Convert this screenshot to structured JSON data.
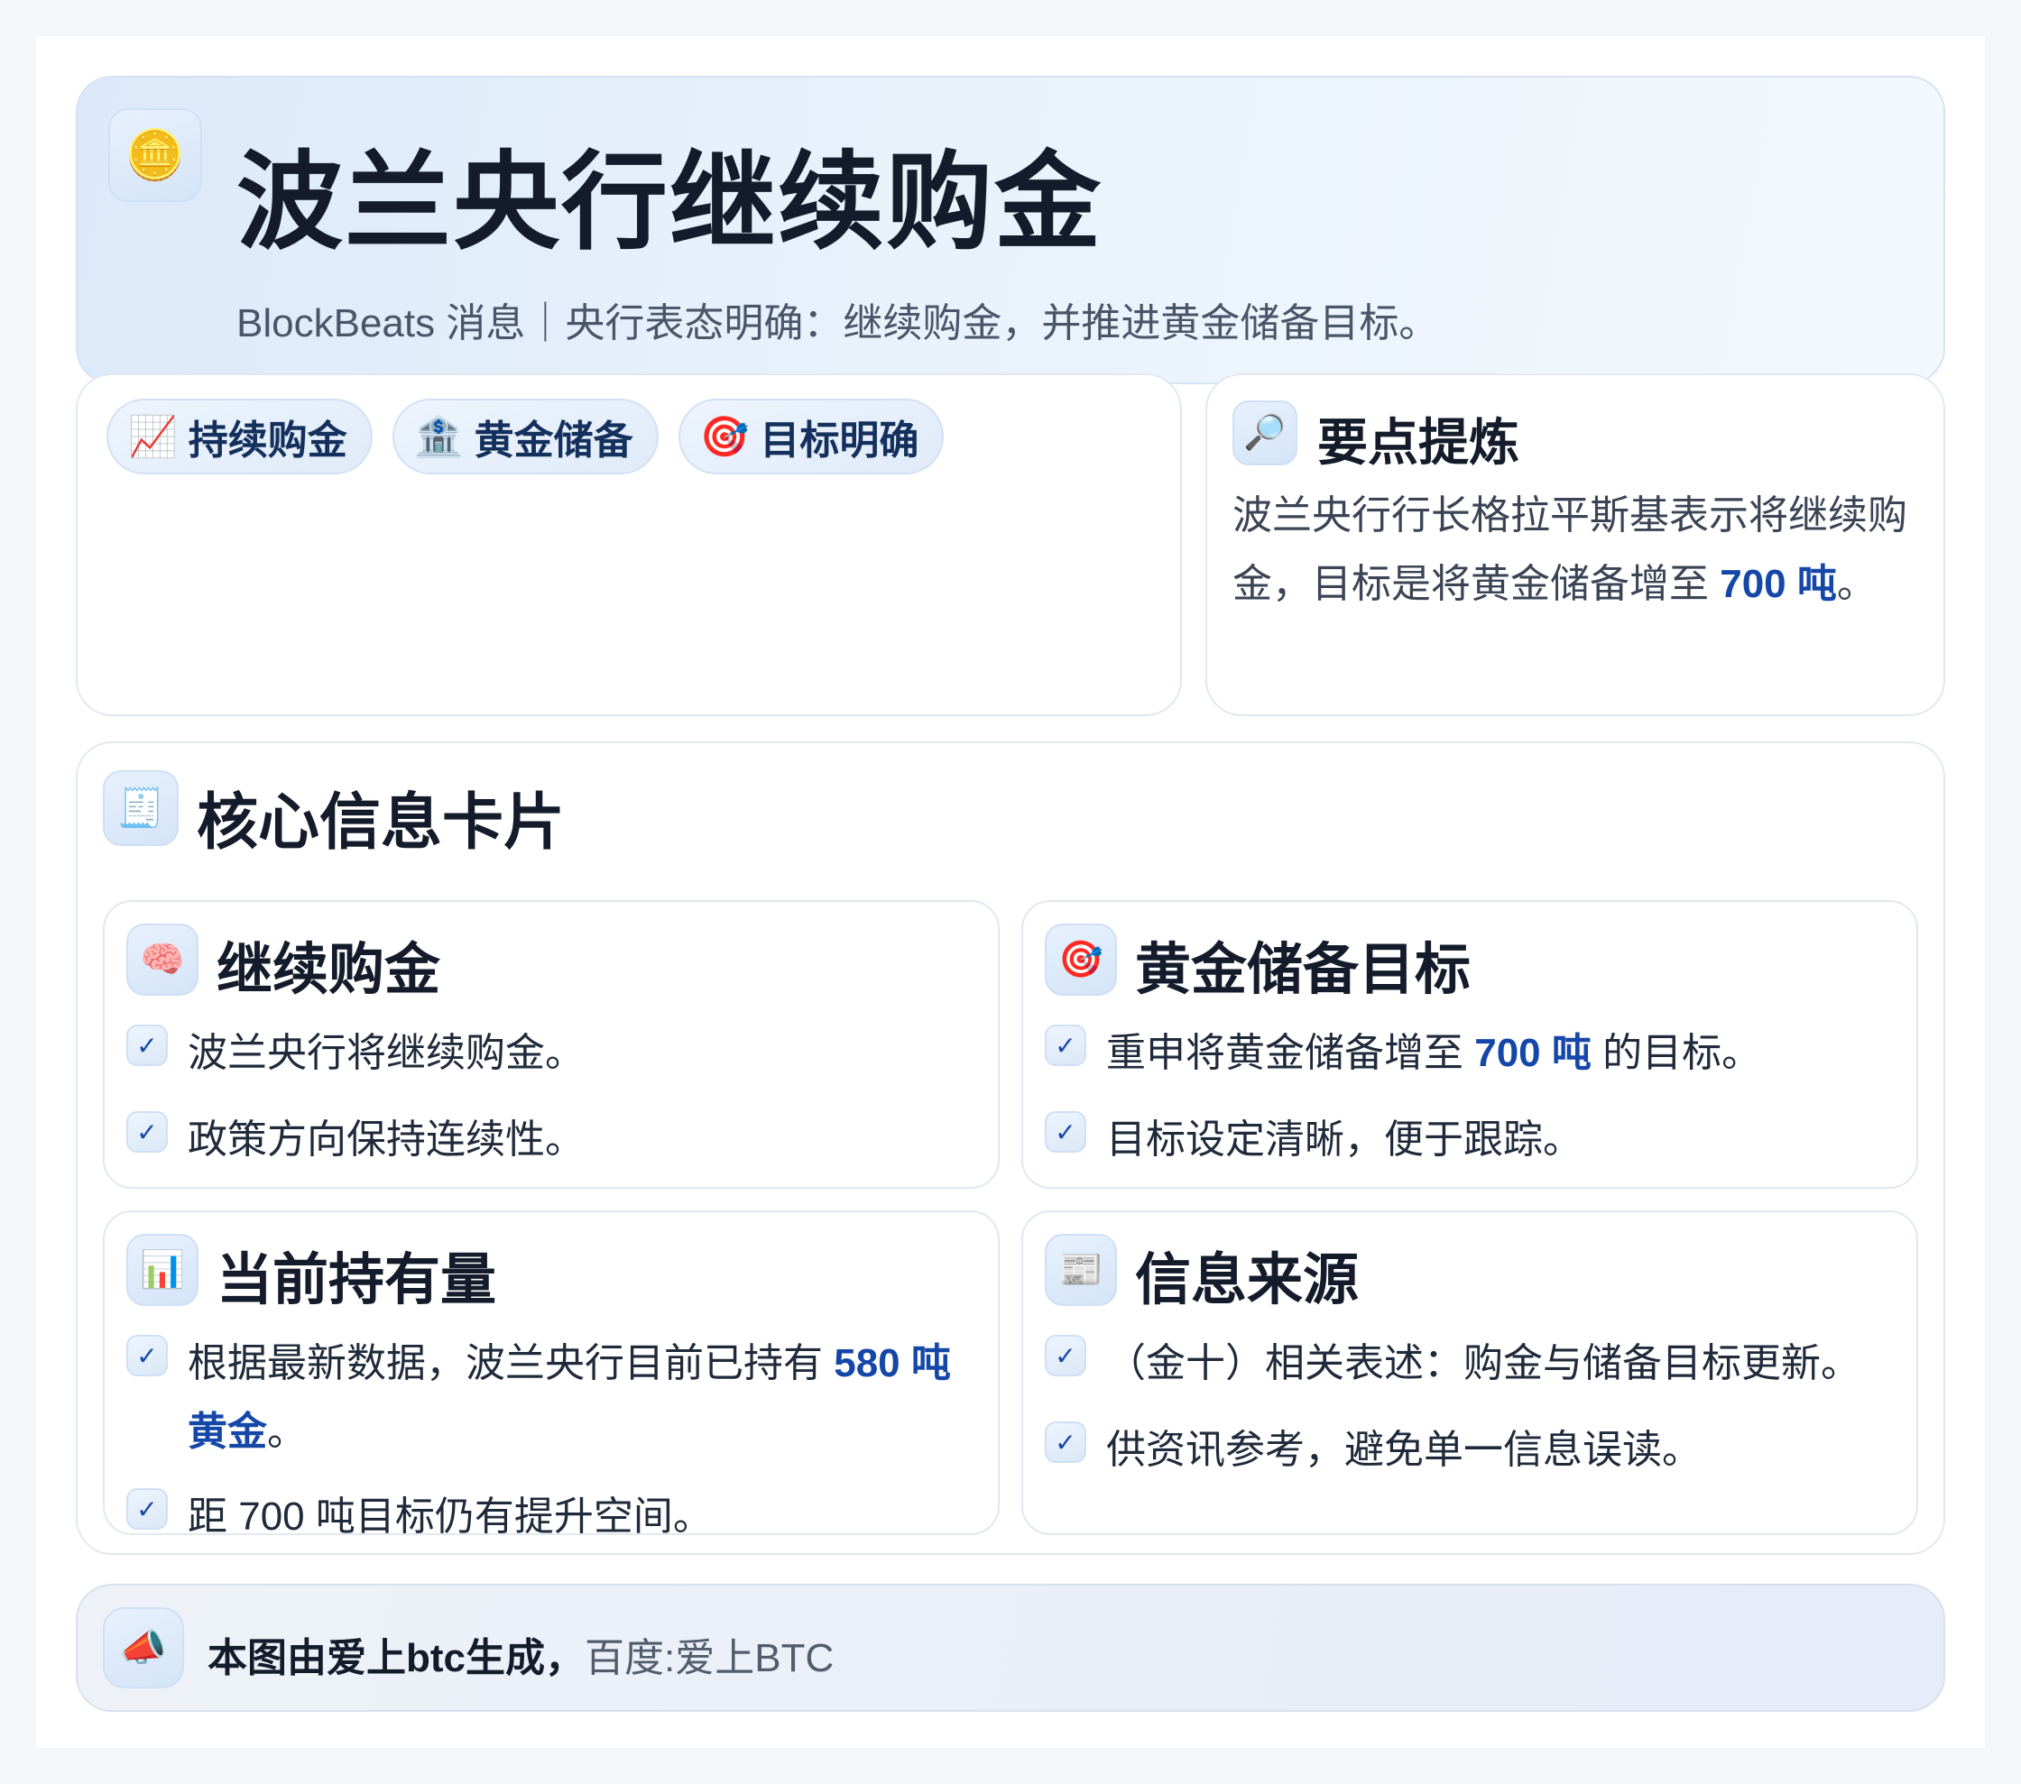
{
  "header": {
    "icon": "gold-coin-bank-icon",
    "icon_glyph": "🪙",
    "title": "波兰央行继续购金",
    "subtitle": "BlockBeats 消息｜央行表态明确：继续购金，并推进黄金储备目标。"
  },
  "tags": [
    {
      "icon": "chart-increasing-icon",
      "glyph": "📈",
      "label": "持续购金"
    },
    {
      "icon": "bank-icon",
      "glyph": "🏦",
      "label": "黄金储备"
    },
    {
      "icon": "target-icon",
      "glyph": "🎯",
      "label": "目标明确"
    }
  ],
  "key_points": {
    "icon": "magnifier-icon",
    "glyph": "🔎",
    "title": "要点提炼",
    "text_before": "波兰央行行长格拉平斯基表示将继续购金，目标是将黄金储备增至 ",
    "highlight": "700 吨",
    "text_after": "。"
  },
  "core": {
    "icon": "receipt-icon",
    "glyph": "🧾",
    "title": "核心信息卡片",
    "cards": [
      {
        "icon": "brain-icon",
        "glyph": "🧠",
        "title": "继续购金",
        "items": [
          {
            "before": "波兰央行将继续购金。",
            "hl": "",
            "after": ""
          },
          {
            "before": "政策方向保持连续性。",
            "hl": "",
            "after": ""
          }
        ]
      },
      {
        "icon": "target-icon",
        "glyph": "🎯",
        "title": "黄金储备目标",
        "items": [
          {
            "before": "重申将黄金储备增至 ",
            "hl": "700 吨",
            "after": " 的目标。"
          },
          {
            "before": "目标设定清晰，便于跟踪。",
            "hl": "",
            "after": ""
          }
        ]
      },
      {
        "icon": "bar-chart-icon",
        "glyph": "📊",
        "title": "当前持有量",
        "items": [
          {
            "before": "根据最新数据，波兰央行目前已持有 ",
            "hl": "580 吨黄金",
            "after": "。"
          },
          {
            "before": "距 700 吨目标仍有提升空间。",
            "hl": "",
            "after": ""
          }
        ]
      },
      {
        "icon": "newspaper-icon",
        "glyph": "📰",
        "title": "信息来源",
        "items": [
          {
            "before": "（金十）相关表述：购金与储备目标更新。",
            "hl": "",
            "after": ""
          },
          {
            "before": "供资讯参考，避免单一信息误读。",
            "hl": "",
            "after": ""
          }
        ]
      }
    ],
    "check_glyph": "✓"
  },
  "footer": {
    "icon": "megaphone-icon",
    "glyph": "📣",
    "bold_text": "本图由爱上btc生成，",
    "text": "百度:爱上BTC"
  }
}
